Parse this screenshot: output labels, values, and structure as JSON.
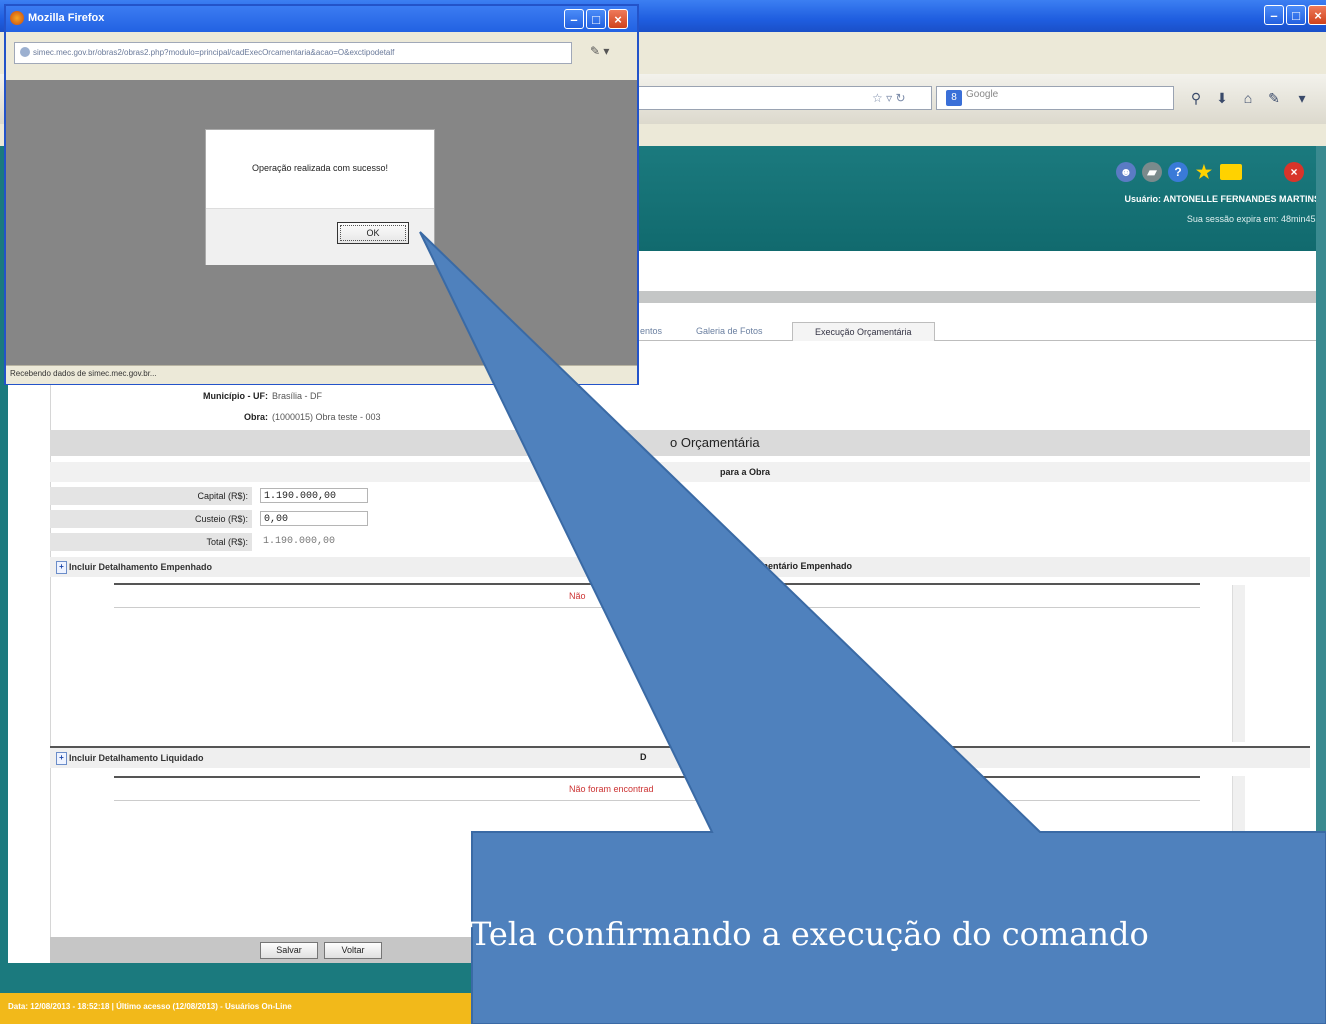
{
  "main_window": {
    "search_placeholder": "Google"
  },
  "header": {
    "user": "Usuário: ANTONELLE FERNANDES MARTINS",
    "session": "Sua sessão expira em: 48min45s"
  },
  "tabs": [
    {
      "label": "entos"
    },
    {
      "label": "Galeria de Fotos"
    },
    {
      "label": "Execução Orçamentária"
    }
  ],
  "form": {
    "municipio_label": "Município - UF:",
    "municipio_value": "Brasília - DF",
    "obra_label": "Obra:",
    "obra_value": "(1000015) Obra teste - 003",
    "section_title": "o Orçamentária",
    "sub_head": "para a Obra",
    "capital_label": "Capital (R$):",
    "capital_value": "1.190.000,00",
    "custeio_label": "Custeio (R$):",
    "custeio_value": "0,00",
    "total_label": "Total (R$):",
    "total_value": "1.190.000,00",
    "empenhado_link": "Incluir Detalhamento Empenhado",
    "empenhado_title": "mentário Empenhado",
    "empenhado_empty": "Não",
    "liquidado_link": "Incluir Detalhamento Liquidado",
    "liquidado_title": "D",
    "liquidado_empty": "Não foram encontrad",
    "save_label": "Salvar",
    "back_label": "Voltar"
  },
  "status_bar": "Data: 12/08/2013 - 18:52:18 | Último acesso (12/08/2013) - Usuários On-Line",
  "popup": {
    "title": "Mozilla Firefox",
    "url": "simec.mec.gov.br/obras2/obras2.php?modulo=principal/cadExecOrcamentaria&acao=O&exctipodetalf",
    "status": "Recebendo dados de simec.mec.gov.br...",
    "alert_message": "Operação realizada com sucesso!",
    "ok_label": "OK"
  },
  "callout": {
    "text": "Tela confirmando a execução do comando",
    "fill": "#4f81bd"
  }
}
